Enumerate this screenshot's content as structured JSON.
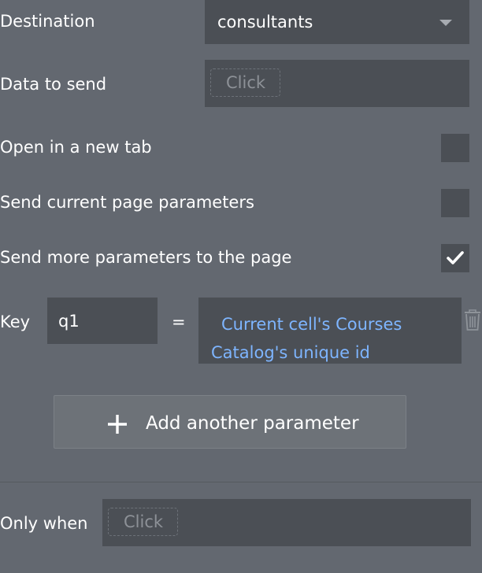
{
  "destination": {
    "label": "Destination",
    "value": "consultants",
    "icon": "chevron-down-icon"
  },
  "data_to_send": {
    "label": "Data to send",
    "placeholder": "Click"
  },
  "open_new_tab": {
    "label": "Open in a new tab",
    "checked": false
  },
  "send_current_params": {
    "label": "Send current page parameters",
    "checked": false
  },
  "send_more_params": {
    "label": "Send more parameters to the page",
    "checked": true
  },
  "parameter": {
    "key_label": "Key",
    "key_value": "q1",
    "equals": "=",
    "value_expression": "Current cell's Courses Catalog's unique id",
    "delete_icon": "trash-icon"
  },
  "add_parameter_button": {
    "label": "Add another parameter",
    "icon": "plus-icon"
  },
  "only_when": {
    "label": "Only when",
    "placeholder": "Click"
  },
  "colors": {
    "panel_background": "#636870",
    "field_background": "#4b4f55",
    "dynamic_text": "#7eb5ff",
    "text": "#ffffff"
  }
}
